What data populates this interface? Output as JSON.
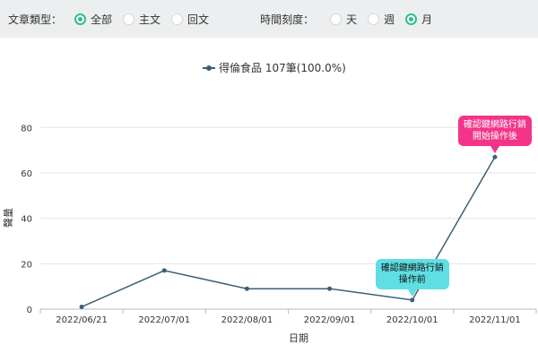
{
  "filters": {
    "article_type": {
      "label": "文章類型：",
      "options": [
        {
          "label": "全部",
          "selected": true
        },
        {
          "label": "主文",
          "selected": false
        },
        {
          "label": "回文",
          "selected": false
        }
      ]
    },
    "time_scale": {
      "label": "時間刻度：",
      "options": [
        {
          "label": "天",
          "selected": false
        },
        {
          "label": "週",
          "selected": false
        },
        {
          "label": "月",
          "selected": true
        }
      ]
    }
  },
  "colors": {
    "line": "#3d5f73",
    "radio_accent": "#2fbf87",
    "callout_before": "#5fdfe3",
    "callout_after": "#f23589",
    "grid": "#e6e6e6",
    "filter_bar_bg": "#eceeef"
  },
  "chart_data": {
    "type": "line",
    "legend": "得倫食品 107筆(100.0%)",
    "legend_position": "top-center",
    "xlabel": "日期",
    "ylabel": "聲量",
    "x": [
      "2022/06/21",
      "2022/07/01",
      "2022/08/01",
      "2022/09/01",
      "2022/10/01",
      "2022/11/01"
    ],
    "x_ticks": [
      "2022/06/21",
      "2022/07/01",
      "2022/08/01",
      "2022/09/01",
      "2022/10/01",
      "2022/11/01"
    ],
    "series": [
      {
        "name": "得倫食品",
        "values": [
          1,
          17,
          9,
          9,
          4,
          67
        ]
      }
    ],
    "ylim": [
      0,
      88
    ],
    "y_ticks": [
      0,
      20,
      40,
      60,
      80
    ],
    "grid": true,
    "annotations": [
      {
        "text": "確認鍵網路行銷\n操作前",
        "x": "2022/10/01",
        "y": 4,
        "style": "before"
      },
      {
        "text": "確認鍵網路行銷\n開始操作後",
        "x": "2022/11/01",
        "y": 67,
        "style": "after"
      }
    ]
  }
}
